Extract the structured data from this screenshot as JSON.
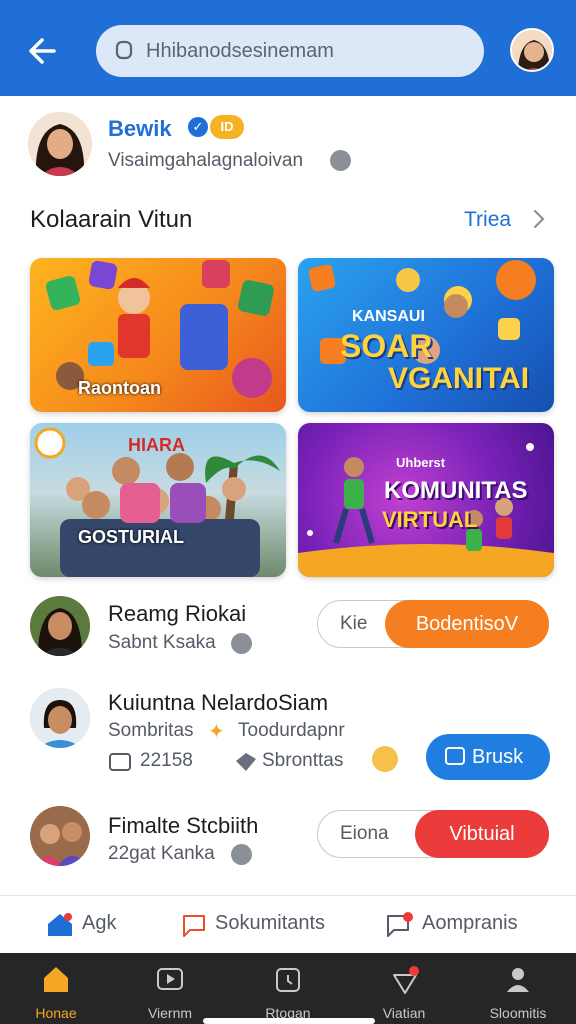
{
  "header": {
    "search_text": "Hhibanodsesinemam"
  },
  "profile": {
    "name": "Bewik",
    "badge": "ID",
    "subtitle": "Visaimgahalagnaloivan"
  },
  "section": {
    "title": "Kolaarain Vitun",
    "more_label": "Triea"
  },
  "cards": [
    {
      "title": "Raontoan"
    },
    {
      "title_top": "KANSAUI",
      "title_main": "SOAR",
      "title_sub": "VGANITAI"
    },
    {
      "title_top": "HIARA",
      "title_bottom": "GOSTURIAL"
    },
    {
      "title_top": "Uhberst",
      "title_main": "KOMUNITAS",
      "title_sub": "VIRTUAL"
    }
  ],
  "feed": [
    {
      "name": "Reamg Riokai",
      "sub": "Sabnt Ksaka",
      "left": "Kie",
      "right": "BodentisoV",
      "color": "#f57f20"
    },
    {
      "name": "Kuiuntna NelardoSiam",
      "sub": "Sombritas",
      "sub2": "Toodurdapnr",
      "meta1": "22158",
      "meta2": "Sbronttas",
      "button": "Brusk"
    },
    {
      "name": "Fimalte Stcbiith",
      "sub": "22gat Kanka",
      "left": "Eiona",
      "right": "Vibtuial",
      "color": "#eb3b3b"
    }
  ],
  "actions": [
    {
      "label": "Agk"
    },
    {
      "label": "Sokumitants"
    },
    {
      "label": "Aompranis"
    }
  ],
  "nav": [
    {
      "label": "Honae"
    },
    {
      "label": "Viernm"
    },
    {
      "label": "Rtoqan"
    },
    {
      "label": "Viatian"
    },
    {
      "label": "Sloomitis"
    }
  ],
  "colors": {
    "brand": "#1f6fd6",
    "accent": "#f57f20",
    "live": "#eb3b3b"
  }
}
